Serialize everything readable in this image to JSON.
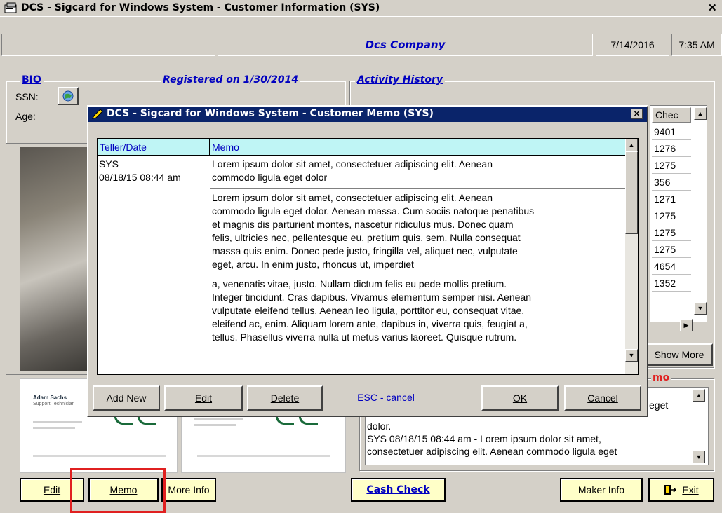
{
  "window": {
    "title": "DCS - Sigcard for Windows System - Customer Information (SYS)",
    "close": "✕"
  },
  "header": {
    "company": "Dcs Company",
    "date": "7/14/2016",
    "time": "7:35 AM"
  },
  "bio": {
    "title": "BIO",
    "registered": "Registered on 1/30/2014",
    "ssn_label": "SSN:",
    "age_label": "Age:"
  },
  "activity": {
    "title": "Activity History",
    "check_header": "Chec",
    "checks": [
      "9401",
      "1276",
      "1275",
      "356",
      "1271",
      "1275",
      "1275",
      "1275",
      "4654",
      "1352"
    ],
    "show_more": "Show More"
  },
  "memo_box": {
    "title": "mo",
    "lines": [
      "eget",
      "dolor.",
      "SYS 08/18/15 08:44 am - Lorem ipsum dolor sit amet,",
      "consectetuer adipiscing elit. Aenean commodo ligula eget"
    ]
  },
  "cards": {
    "left": {
      "name": "Adam Sachs",
      "role": "Support Technician"
    }
  },
  "bottom": {
    "edit": "Edit",
    "memo": "Memo",
    "more_info": "More Info",
    "cash_check": "Cash Check",
    "maker_info": "Maker Info",
    "exit": "Exit"
  },
  "modal": {
    "title": "DCS - Sigcard for Windows System - Customer Memo (SYS)",
    "close": "✕",
    "col_teller": "Teller/Date",
    "col_memo": "Memo",
    "rows": [
      {
        "teller": "SYS",
        "date": "08/18/15 08:44 am",
        "memo": [
          "Lorem ipsum dolor sit amet, consectetuer adipiscing elit. Aenean",
          "commodo ligula eget dolor"
        ]
      },
      {
        "teller": "",
        "date": "",
        "memo": [
          "Lorem ipsum dolor sit amet, consectetuer adipiscing elit. Aenean",
          "commodo ligula eget dolor. Aenean massa. Cum sociis natoque penatibus",
          "et magnis dis parturient montes, nascetur ridiculus mus. Donec quam",
          "felis, ultricies nec, pellentesque eu, pretium quis, sem. Nulla consequat",
          "massa quis enim. Donec pede justo, fringilla vel, aliquet nec, vulputate",
          "eget, arcu. In enim justo, rhoncus ut, imperdiet"
        ]
      },
      {
        "teller": "",
        "date": "",
        "memo": [
          "a, venenatis vitae, justo. Nullam dictum felis eu pede mollis pretium.",
          "Integer tincidunt. Cras dapibus. Vivamus elementum semper nisi. Aenean",
          "vulputate eleifend tellus. Aenean leo ligula, porttitor eu, consequat vitae,",
          "eleifend ac, enim. Aliquam lorem ante, dapibus in, viverra quis, feugiat a,",
          "tellus. Phasellus viverra nulla ut metus varius laoreet. Quisque rutrum."
        ]
      }
    ],
    "buttons": {
      "add_new": "Add New",
      "edit": "Edit",
      "delete": "Delete",
      "esc": "ESC - cancel",
      "ok": "OK",
      "cancel": "Cancel"
    }
  },
  "colors": {
    "accent_blue": "#0000c0",
    "highlight_red": "#e02020",
    "title_bar": "#0a246a",
    "yellow_btn": "#ffffc8"
  }
}
